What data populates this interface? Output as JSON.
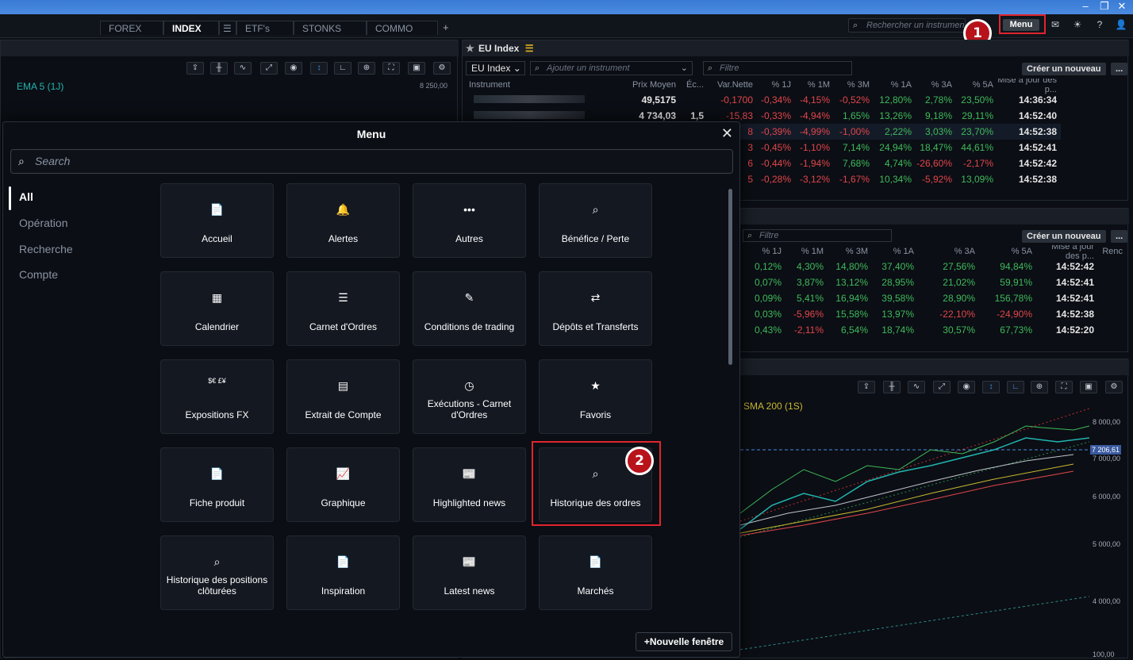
{
  "tabs": [
    {
      "label": "FOREX",
      "active": false
    },
    {
      "label": "INDEX",
      "active": true
    },
    {
      "label": "ETF's",
      "active": false
    },
    {
      "label": "STONKS",
      "active": false
    },
    {
      "label": "COMMO",
      "active": false
    }
  ],
  "tab_add": "+",
  "top_search_placeholder": "Rechercher un instrument",
  "menu_button": "Menu",
  "callouts": [
    "1",
    "2"
  ],
  "left_chart": {
    "indicator": "EMA 5 (1J)",
    "price_label": "8 250,00"
  },
  "eu_panel": {
    "title": "EU Index",
    "list_select": "EU Index",
    "add_placeholder": "Ajouter un instrument",
    "filter_placeholder": "Filtre",
    "create_button": "Créer un nouveau",
    "more_button": "...",
    "headers": [
      "Instrument",
      "Prix Moyen",
      "Éc...",
      "Var.Nette",
      "% 1J",
      "% 1M",
      "% 3M",
      "% 1A",
      "% 3A",
      "% 5A",
      "Mise à jour des p..."
    ],
    "rows": [
      {
        "price": "49,5175",
        "ec": "",
        "var": "-0,1700",
        "d1": "-0,34%",
        "m1": "-4,15%",
        "m3": "-0,52%",
        "a1": "12,80%",
        "a3": "2,78%",
        "a5": "23,50%",
        "time": "14:36:34"
      },
      {
        "price": "4 734,03",
        "ec": "1,5",
        "var": "-15,83",
        "d1": "-0,33%",
        "m1": "-4,94%",
        "m3": "1,65%",
        "a1": "13,26%",
        "a3": "9,18%",
        "a5": "29,11%",
        "time": "14:52:40"
      },
      {
        "price": "",
        "ec": "",
        "var": "8",
        "d1": "-0,39%",
        "m1": "-4,99%",
        "m3": "-1,00%",
        "a1": "2,22%",
        "a3": "3,03%",
        "a5": "23,70%",
        "time": "14:52:38"
      },
      {
        "price": "",
        "ec": "",
        "var": "3",
        "d1": "-0,45%",
        "m1": "-1,10%",
        "m3": "7,14%",
        "a1": "24,94%",
        "a3": "18,47%",
        "a5": "44,61%",
        "time": "14:52:41"
      },
      {
        "price": "",
        "ec": "",
        "var": "6",
        "d1": "-0,44%",
        "m1": "-1,94%",
        "m3": "7,68%",
        "a1": "4,74%",
        "a3": "-26,60%",
        "a5": "-2,17%",
        "time": "14:52:42"
      },
      {
        "price": "",
        "ec": "",
        "var": "5",
        "d1": "-0,28%",
        "m1": "-3,12%",
        "m3": "-1,67%",
        "a1": "10,34%",
        "a3": "-5,92%",
        "a5": "13,09%",
        "time": "14:52:38"
      }
    ]
  },
  "second_panel": {
    "filter_placeholder": "Filtre",
    "create_button": "Créer un nouveau",
    "more_button": "...",
    "headers": [
      "% 1J",
      "% 1M",
      "% 3M",
      "% 1A",
      "% 3A",
      "% 5A",
      "Mise à jour des p...",
      "Renc"
    ],
    "rows": [
      {
        "d1": "0,12%",
        "m1": "4,30%",
        "m3": "14,80%",
        "a1": "37,40%",
        "a3": "27,56%",
        "a5": "94,84%",
        "time": "14:52:42"
      },
      {
        "d1": "0,07%",
        "m1": "3,87%",
        "m3": "13,12%",
        "a1": "28,95%",
        "a3": "21,02%",
        "a5": "59,91%",
        "time": "14:52:41"
      },
      {
        "d1": "0,09%",
        "m1": "5,41%",
        "m3": "16,94%",
        "a1": "39,58%",
        "a3": "28,90%",
        "a5": "156,78%",
        "time": "14:52:41"
      },
      {
        "d1": "0,03%",
        "m1": "-5,96%",
        "m3": "15,58%",
        "a1": "13,97%",
        "a3": "-22,10%",
        "a5": "-24,90%",
        "time": "14:52:38"
      },
      {
        "d1": "0,43%",
        "m1": "-2,11%",
        "m3": "6,54%",
        "a1": "18,74%",
        "a3": "30,57%",
        "a5": "67,73%",
        "time": "14:52:20"
      }
    ]
  },
  "right_chart": {
    "indicator": "SMA 200 (1S)",
    "price_labels": [
      "8 000,00",
      "7 206,61",
      "7 000,00",
      "6 000,00",
      "5 000,00",
      "4 000,00",
      "100,00"
    ]
  },
  "modal": {
    "title": "Menu",
    "close": "✕",
    "search_placeholder": "Search",
    "sidebar": [
      "All",
      "Opération",
      "Recherche",
      "Compte"
    ],
    "tiles": [
      {
        "label": "Accueil",
        "icon": "📄"
      },
      {
        "label": "Alertes",
        "icon": "🔔"
      },
      {
        "label": "Autres",
        "icon": "•••"
      },
      {
        "label": "Bénéfice / Perte",
        "icon": "⌕"
      },
      {
        "label": "Calendrier",
        "icon": "▦"
      },
      {
        "label": "Carnet d'Ordres",
        "icon": "☰"
      },
      {
        "label": "Conditions de trading",
        "icon": "✎"
      },
      {
        "label": "Dépôts et Transferts",
        "icon": "⇄"
      },
      {
        "label": "Expositions FX",
        "icon": "$€ £¥"
      },
      {
        "label": "Extrait de Compte",
        "icon": "▤"
      },
      {
        "label": "Exécutions - Carnet d'Ordres",
        "icon": "◷"
      },
      {
        "label": "Favoris",
        "icon": "★"
      },
      {
        "label": "Fiche produit",
        "icon": "📄"
      },
      {
        "label": "Graphique",
        "icon": "📈"
      },
      {
        "label": "Highlighted news",
        "icon": "📰"
      },
      {
        "label": "Historique des ordres",
        "icon": "⌕"
      },
      {
        "label": "Historique des positions clôturées",
        "icon": "⌕"
      },
      {
        "label": "Inspiration",
        "icon": "📄"
      },
      {
        "label": "Latest news",
        "icon": "📰"
      },
      {
        "label": "Marchés",
        "icon": "📄"
      }
    ],
    "new_window": "+Nouvelle fenêtre"
  }
}
